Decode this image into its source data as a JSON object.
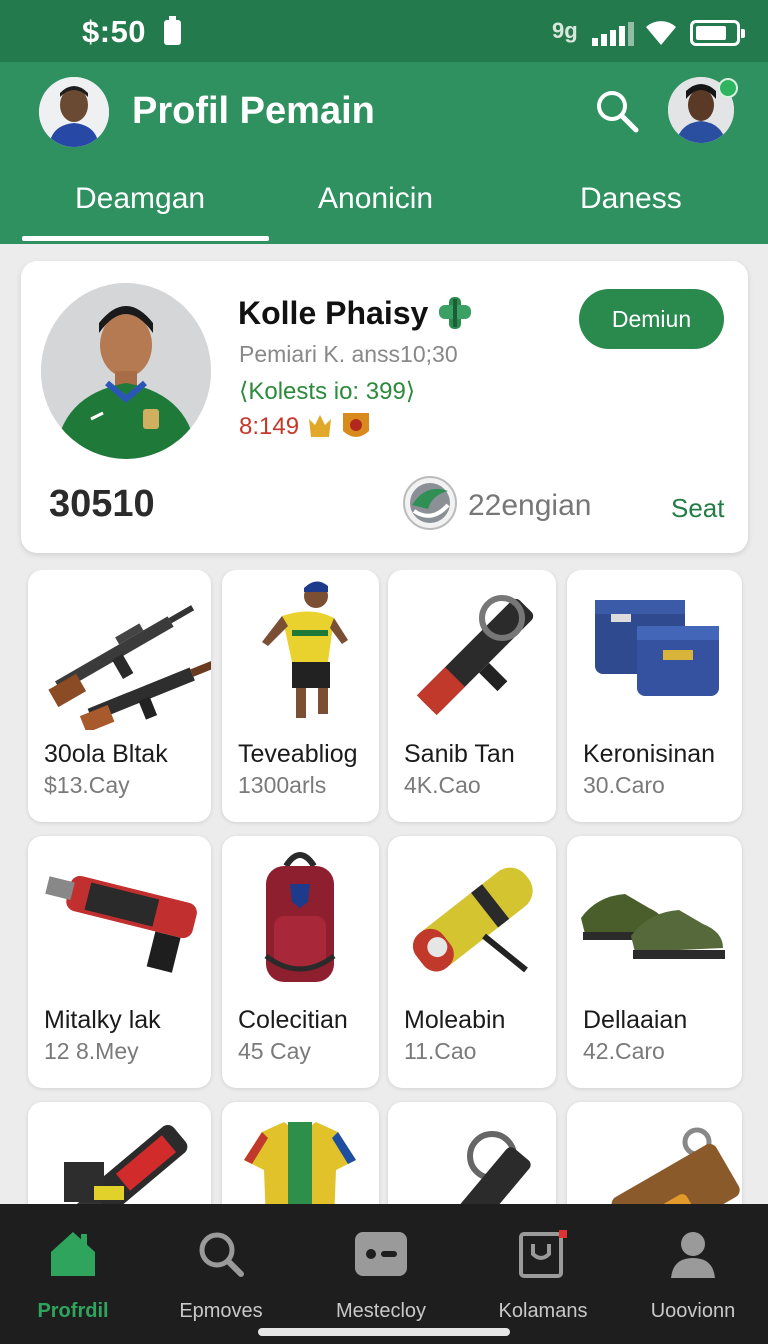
{
  "status_bar": {
    "time": "$:50",
    "dual_sim": "9g"
  },
  "header": {
    "title": "Profil Pemain",
    "tabs": [
      {
        "label": "Deamgan"
      },
      {
        "label": "Anonicin"
      },
      {
        "label": "Daness"
      }
    ]
  },
  "profile": {
    "name": "Kolle Phaisy",
    "meta": "Pemiari K. anss10;30",
    "stat": "⟨Kolests io: 399⟩",
    "rank": "8:149",
    "premium_label": "Demiun",
    "score": "30510",
    "team": "22engian",
    "seat_label": "Seat"
  },
  "items": [
    {
      "title": "30ola Bltak",
      "price": "$13.Cay",
      "icon": "rifles"
    },
    {
      "title": "Teveabliog",
      "price": "1300arls",
      "icon": "player-figure"
    },
    {
      "title": "Sanib Tan",
      "price": "4K.Cao",
      "icon": "launcher"
    },
    {
      "title": "Keronisinan",
      "price": "30.Caro",
      "icon": "ammo-case"
    },
    {
      "title": "Mitalky lak",
      "price": "12 8.Mey",
      "icon": "heavy-gun"
    },
    {
      "title": "Colecitian",
      "price": "45 Cay",
      "icon": "backpack"
    },
    {
      "title": "Moleabin",
      "price": "11.Cao",
      "icon": "tube-launcher"
    },
    {
      "title": "Dellaaian",
      "price": "42.Caro",
      "icon": "shoes"
    },
    {
      "title": "",
      "price": "",
      "icon": "chainsaw"
    },
    {
      "title": "",
      "price": "",
      "icon": "jersey"
    },
    {
      "title": "",
      "price": "",
      "icon": "strap"
    },
    {
      "title": "",
      "price": "",
      "icon": "bag"
    }
  ],
  "bottom_nav": [
    {
      "label": "Profrdil",
      "icon": "home-icon"
    },
    {
      "label": "Epmoves",
      "icon": "search-icon"
    },
    {
      "label": "Mestecloy",
      "icon": "wallet-icon"
    },
    {
      "label": "Kolamans",
      "icon": "bag-icon"
    },
    {
      "label": "Uoovionn",
      "icon": "user-icon"
    }
  ],
  "colors": {
    "primary": "#2f9060",
    "status": "#237a4c",
    "accent_green": "#2a8a4e",
    "nav_bg": "#1e1e1e"
  }
}
